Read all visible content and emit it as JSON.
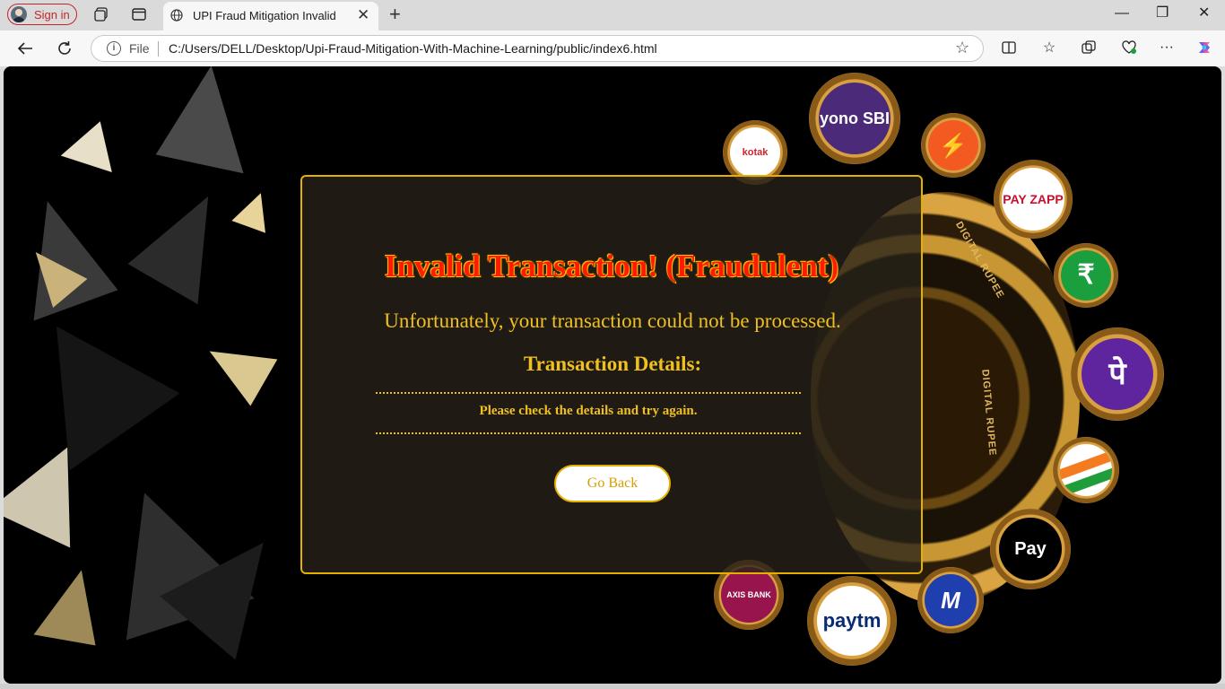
{
  "browser": {
    "signin_label": "Sign in",
    "tab_title": "UPI Fraud Mitigation Invalid",
    "address_protocol": "File",
    "address_url": "C:/Users/DELL/Desktop/Upi-Fraud-Mitigation-With-Machine-Learning/public/index6.html",
    "icons": [
      "profile-avatar-icon",
      "workspaces-icon",
      "tab-actions-icon",
      "globe-icon",
      "close-icon",
      "new-tab-icon",
      "minimize-icon",
      "restore-icon",
      "window-close-icon",
      "back-icon",
      "refresh-icon",
      "info-icon",
      "favorite-star-icon",
      "split-screen-icon",
      "favorites-icon",
      "collections-icon",
      "browser-essentials-icon",
      "more-icon",
      "copilot-icon"
    ]
  },
  "page": {
    "heading": "Invalid Transaction! (Fraudulent)",
    "message": "Unfortunately, your transaction could not be processed.",
    "details_heading": "Transaction Details:",
    "details_text": "Please check the details and try again.",
    "back_button": "Go Back"
  },
  "background": {
    "coin_text": "DIGITAL RUPEE",
    "badges": [
      {
        "name": "kotak",
        "text": "kotak"
      },
      {
        "name": "yono-sbi",
        "text": "yono SBI"
      },
      {
        "name": "freecharge",
        "text": "⚡"
      },
      {
        "name": "payzapp",
        "text": "PAY ZAPP"
      },
      {
        "name": "rupee",
        "text": "₹"
      },
      {
        "name": "phonepe",
        "text": "पे"
      },
      {
        "name": "upi-flag",
        "text": ""
      },
      {
        "name": "apple-pay",
        "text": "Pay"
      },
      {
        "name": "mobikwik",
        "text": "M"
      },
      {
        "name": "paytm",
        "text": "paytm"
      },
      {
        "name": "axis-bank",
        "text": "AXIS BANK"
      }
    ]
  }
}
